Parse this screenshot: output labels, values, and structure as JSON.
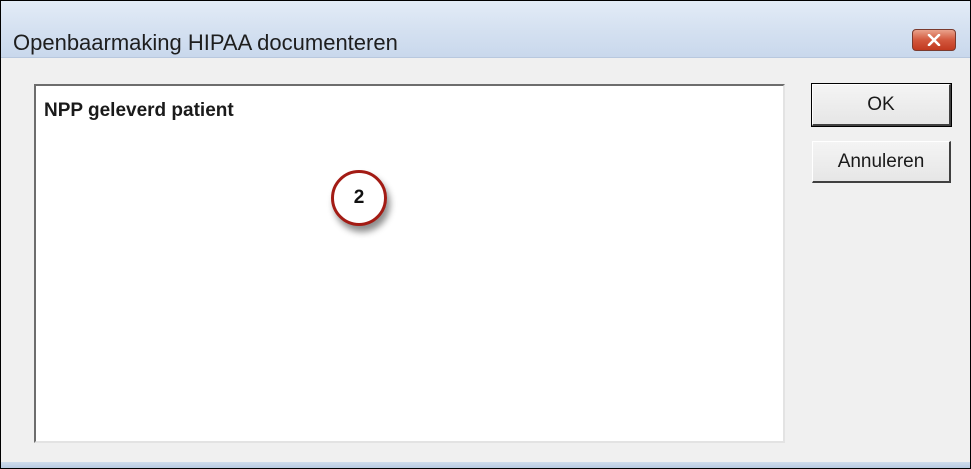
{
  "window": {
    "title": "Openbaarmaking HIPAA documenteren",
    "close_icon": "close-x-icon"
  },
  "textbox": {
    "value": "NPP geleverd patient"
  },
  "annotation": {
    "marker_number": "2",
    "marker_color": "#a31b14"
  },
  "buttons": {
    "ok_label": "OK",
    "cancel_label": "Annuleren"
  },
  "colors": {
    "titlebar": "#d5e1f1",
    "close_button": "#c1391f",
    "dialog_bg": "#f0f0f0"
  }
}
